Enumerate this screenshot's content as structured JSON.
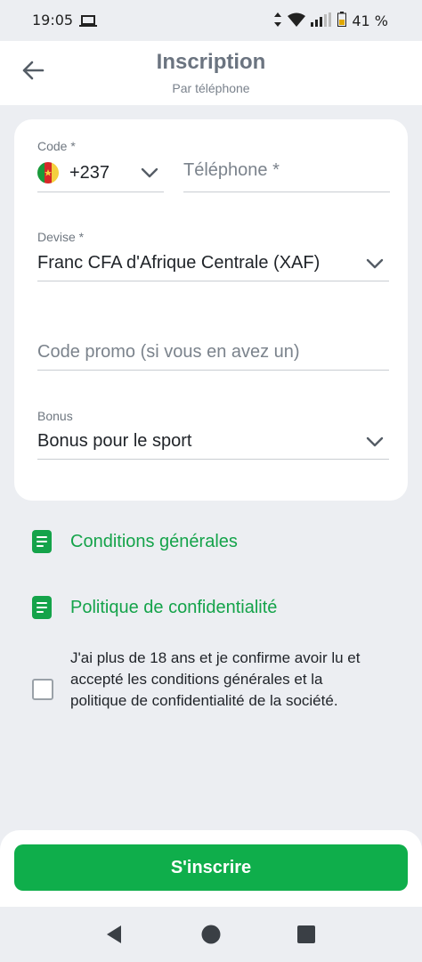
{
  "status_bar": {
    "time": "19:05",
    "battery": "41 %"
  },
  "header": {
    "title": "Inscription",
    "subtitle": "Par téléphone"
  },
  "form": {
    "code": {
      "label": "Code *",
      "value": "+237",
      "flag": "cameroon-flag"
    },
    "phone": {
      "placeholder": "Téléphone *",
      "value": ""
    },
    "currency": {
      "label": "Devise *",
      "value": "Franc CFA d'Afrique Centrale (XAF)"
    },
    "promo": {
      "placeholder": "Code promo (si vous en avez un)",
      "value": ""
    },
    "bonus": {
      "label": "Bonus",
      "value": "Bonus pour le sport"
    }
  },
  "links": {
    "terms": "Conditions générales",
    "privacy": "Politique de confidentialité"
  },
  "agreement": {
    "text": "J'ai plus de 18 ans et je confirme avoir lu et accepté les conditions générales et la politique de confidentialité de la société.",
    "checked": false
  },
  "submit_label": "S'inscrire",
  "colors": {
    "accent": "#0fae4b",
    "link": "#14a34a",
    "background": "#eceef2"
  }
}
